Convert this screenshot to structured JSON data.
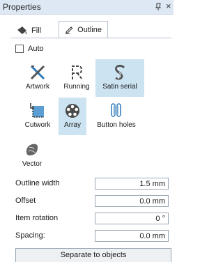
{
  "panel": {
    "title": "Properties",
    "close_glyph": "×"
  },
  "tabs": [
    {
      "label": "Fill",
      "icon": "paint-bucket-icon",
      "selected": false
    },
    {
      "label": "Outline",
      "icon": "pen-icon",
      "selected": true
    }
  ],
  "auto": {
    "label": "Auto",
    "checked": false
  },
  "tools": [
    {
      "label": "Artwork",
      "icon": "artwork-icon",
      "selected": false
    },
    {
      "label": "Running",
      "icon": "running-stitch-icon",
      "selected": false
    },
    {
      "label": "Satin serial",
      "icon": "satin-serial-icon",
      "selected": true
    },
    {
      "label": "Cutwork",
      "icon": "cutwork-icon",
      "selected": false
    },
    {
      "label": "Array",
      "icon": "array-icon",
      "selected": true
    },
    {
      "label": "Button holes",
      "icon": "button-holes-icon",
      "selected": false
    },
    {
      "label": "Vector",
      "icon": "vector-icon",
      "selected": false
    }
  ],
  "fields": [
    {
      "label": "Outline width",
      "value": "1.5 mm"
    },
    {
      "label": "Offset",
      "value": "0.0 mm"
    },
    {
      "label": "Item rotation",
      "value": "0 °"
    },
    {
      "label": "Spacing:",
      "value": "0.0 mm"
    }
  ],
  "separate_button": {
    "label": "Separate to objects"
  },
  "colors": {
    "accent": "#cce3f2",
    "titlebar": "#dde8f4",
    "icon_blue": "#2f79b8"
  }
}
